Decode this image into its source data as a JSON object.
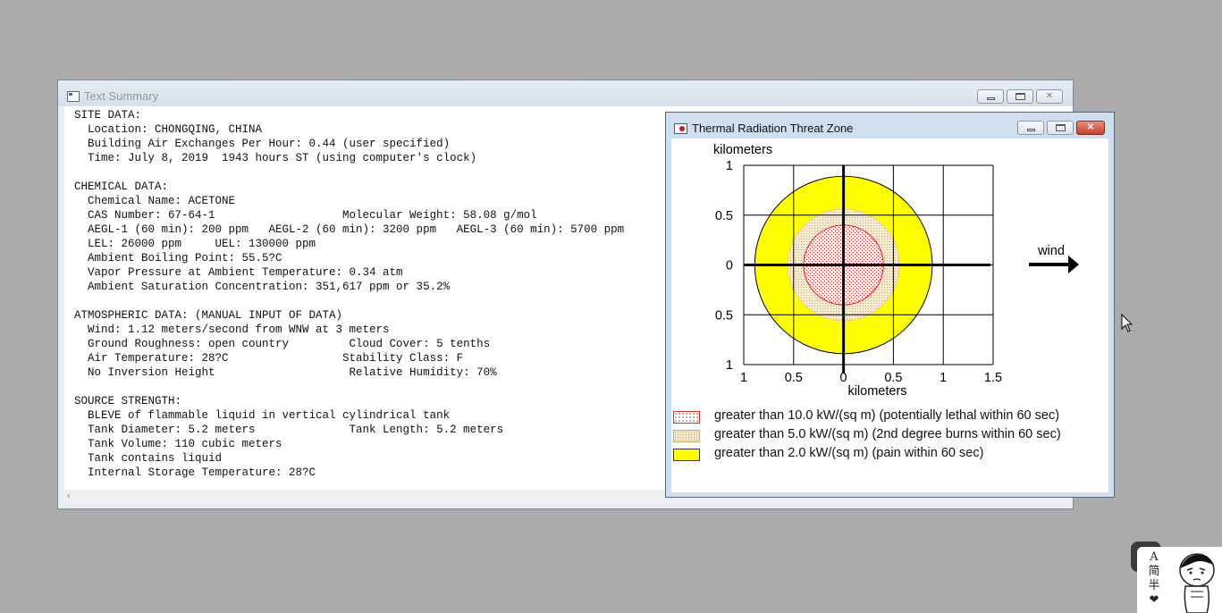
{
  "text_summary_window": {
    "title": "Text Summary",
    "lines": [
      "SITE DATA:",
      "  Location: CHONGQING, CHINA",
      "  Building Air Exchanges Per Hour: 0.44 (user specified)",
      "  Time: July 8, 2019  1943 hours ST (using computer's clock)",
      "",
      "CHEMICAL DATA:",
      "  Chemical Name: ACETONE",
      "  CAS Number: 67-64-1                   Molecular Weight: 58.08 g/mol",
      "  AEGL-1 (60 min): 200 ppm   AEGL-2 (60 min): 3200 ppm   AEGL-3 (60 min): 5700 ppm",
      "  LEL: 26000 ppm     UEL: 130000 ppm",
      "  Ambient Boiling Point: 55.5?C",
      "  Vapor Pressure at Ambient Temperature: 0.34 atm",
      "  Ambient Saturation Concentration: 351,617 ppm or 35.2%",
      "",
      "ATMOSPHERIC DATA: (MANUAL INPUT OF DATA)",
      "  Wind: 1.12 meters/second from WNW at 3 meters",
      "  Ground Roughness: open country         Cloud Cover: 5 tenths",
      "  Air Temperature: 28?C                 Stability Class: F",
      "  No Inversion Height                    Relative Humidity: 70%",
      "",
      "SOURCE STRENGTH:",
      "  BLEVE of flammable liquid in vertical cylindrical tank",
      "  Tank Diameter: 5.2 meters              Tank Length: 5.2 meters",
      "  Tank Volume: 110 cubic meters",
      "  Tank contains liquid",
      "  Internal Storage Temperature: 28?C"
    ],
    "scroll_left_glyph": "‹"
  },
  "threat_zone_window": {
    "title": "Thermal Radiation Threat Zone",
    "close_glyph": "✕",
    "wind_label": "wind",
    "legend": [
      {
        "label": "greater than 10.0 kW/(sq m) (potentially lethal within 60 sec)",
        "color": "#ffffff",
        "pattern": "red-dots"
      },
      {
        "label": "greater than 5.0 kW/(sq m) (2nd degree burns within 60 sec)",
        "color": "#f7ecd0",
        "pattern": "tan-dots"
      },
      {
        "label": "greater than 2.0 kW/(sq m) (pain within 60 sec)",
        "color": "#ffff00",
        "pattern": "solid"
      }
    ]
  },
  "chart_data": {
    "type": "area",
    "title": "",
    "xlabel": "kilometers",
    "ylabel": "kilometers",
    "xlim": [
      -1,
      1.5
    ],
    "ylim": [
      -1,
      1
    ],
    "x_ticks": [
      -1,
      -0.5,
      0,
      0.5,
      1,
      1.5
    ],
    "x_tick_labels": [
      "1",
      "0.5",
      "0",
      "0.5",
      "1",
      "1.5"
    ],
    "y_ticks": [
      1,
      0.5,
      0,
      -0.5,
      -1
    ],
    "y_tick_labels": [
      "1",
      "0.5",
      "0",
      "0.5",
      "1"
    ],
    "grid": true,
    "series": [
      {
        "name": "greater than 2.0 kW/(sq m) (pain within 60 sec)",
        "shape": "circle",
        "center": [
          0,
          0
        ],
        "radius_km": 0.89,
        "color": "#ffff00"
      },
      {
        "name": "greater than 5.0 kW/(sq m) (2nd degree burns within 60 sec)",
        "shape": "circle",
        "center": [
          0,
          0
        ],
        "radius_km": 0.56,
        "color": "#f7ecd0"
      },
      {
        "name": "greater than 10.0 kW/(sq m) (potentially lethal within 60 sec)",
        "shape": "circle",
        "center": [
          0,
          0
        ],
        "radius_km": 0.4,
        "color": "#ffffff"
      }
    ]
  },
  "widget": {
    "chars": [
      "A",
      "简",
      "半",
      "❤"
    ]
  }
}
